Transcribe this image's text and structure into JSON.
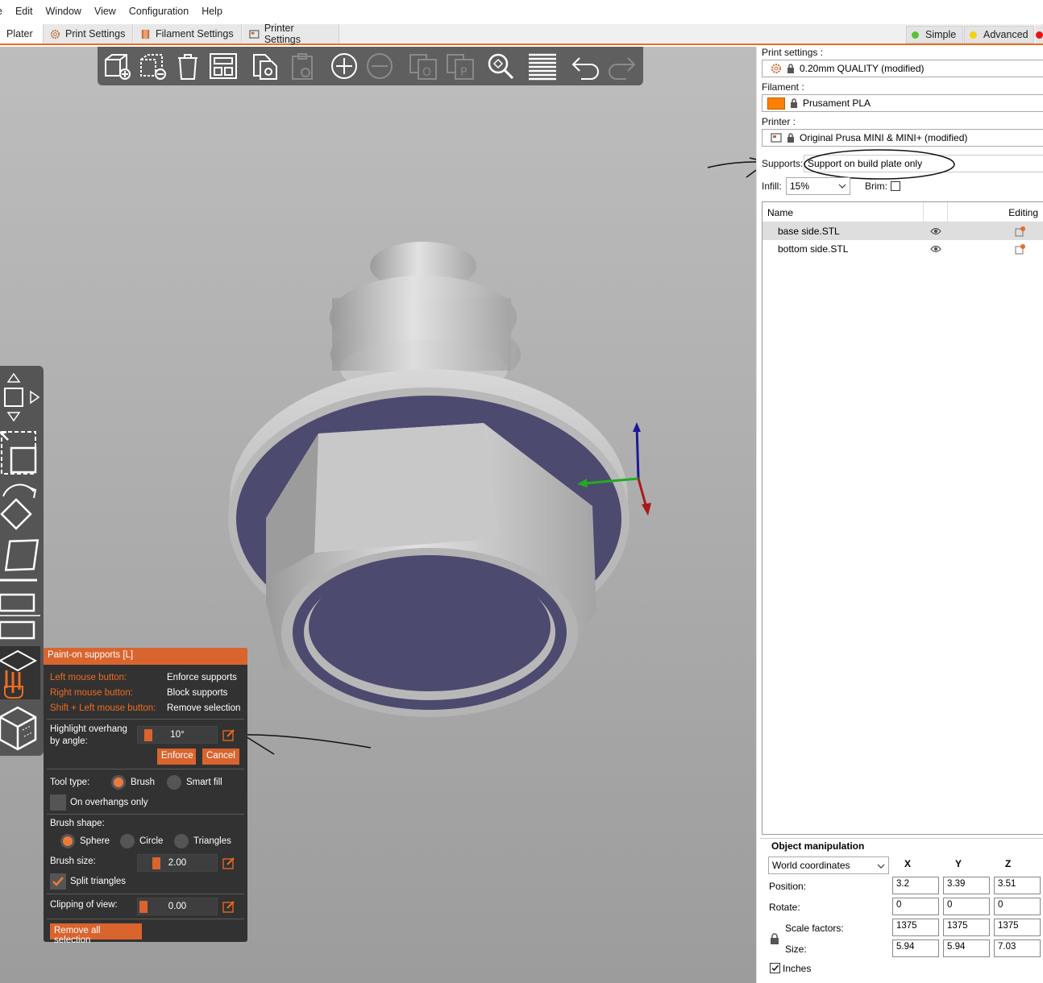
{
  "menu": [
    "e",
    "Edit",
    "Window",
    "View",
    "Configuration",
    "Help"
  ],
  "tabs": [
    {
      "label": "Plater",
      "active": true
    },
    {
      "label": "Print Settings",
      "icon": "gear-icon"
    },
    {
      "label": "Filament Settings",
      "icon": "spool-icon"
    },
    {
      "label": "Printer Settings",
      "icon": "printer-icon"
    }
  ],
  "modes": [
    {
      "label": "Simple",
      "color": "#5bc236"
    },
    {
      "label": "Advanced",
      "color": "#f5d20c"
    }
  ],
  "toolbar": {
    "icons": [
      "add-icon",
      "delete-icon",
      "delete-all-icon",
      "arrange-icon",
      "copy-icon",
      "paste-icon",
      "add-instance-icon",
      "remove-instance-icon",
      "split-objects-icon",
      "split-parts-icon",
      "search-icon",
      "layers-icon",
      "undo-icon",
      "redo-icon"
    ]
  },
  "left_tools": {
    "icons": [
      "move-icon",
      "scale-icon",
      "rotate-icon",
      "place-on-face-icon",
      "cut-icon",
      "paint-supports-icon",
      "sla-supports-icon"
    ]
  },
  "paint_panel": {
    "title": "Paint-on supports [L]",
    "left_mouse_label": "Left mouse button:",
    "left_mouse_value": "Enforce supports",
    "right_mouse_label": "Right mouse button:",
    "right_mouse_value": "Block supports",
    "shift_label": "Shift + Left mouse button:",
    "shift_value": "Remove selection",
    "highlight_label_1": "Highlight overhang",
    "highlight_label_2": "by angle:",
    "highlight_value": "10°",
    "enforce_label": "Enforce",
    "cancel_label": "Cancel",
    "tool_type_label": "Tool type:",
    "tool_brush": "Brush",
    "tool_smartfill": "Smart fill",
    "overhangs_only": "On overhangs only",
    "brush_shape_label": "Brush shape:",
    "shape_sphere": "Sphere",
    "shape_circle": "Circle",
    "shape_triangles": "Triangles",
    "brush_size_label": "Brush size:",
    "brush_size_value": "2.00",
    "split_triangles": "Split triangles",
    "clipping_label": "Clipping of view:",
    "clipping_value": "0.00",
    "remove_all": "Remove all selection"
  },
  "sidebar": {
    "print_settings_label": "Print settings :",
    "print_settings_value": "0.20mm QUALITY (modified)",
    "filament_label": "Filament :",
    "filament_value": "Prusament PLA",
    "filament_color": "#ff8000",
    "printer_label": "Printer :",
    "printer_value": "Original Prusa MINI & MINI+ (modified)",
    "supports_label": "Supports:",
    "supports_value": "Support on build plate only",
    "infill_label": "Infill:",
    "infill_value": "15%",
    "brim_label": "Brim:"
  },
  "object_list": {
    "col_name": "Name",
    "col_editing": "Editing",
    "rows": [
      {
        "name": "base side.STL",
        "selected": true
      },
      {
        "name": "bottom side.STL",
        "selected": false
      }
    ]
  },
  "manipulation": {
    "title": "Object manipulation",
    "coord_system": "World coordinates",
    "axes": [
      "X",
      "Y",
      "Z"
    ],
    "position_label": "Position:",
    "position": [
      "3.2",
      "3.39",
      "3.51"
    ],
    "rotate_label": "Rotate:",
    "rotate": [
      "0",
      "0",
      "0"
    ],
    "scale_label": "Scale factors:",
    "scale": [
      "1375",
      "1375",
      "1375"
    ],
    "size_label": "Size:",
    "size": [
      "5.94",
      "5.94",
      "7.03"
    ],
    "inches_label": "Inches"
  }
}
